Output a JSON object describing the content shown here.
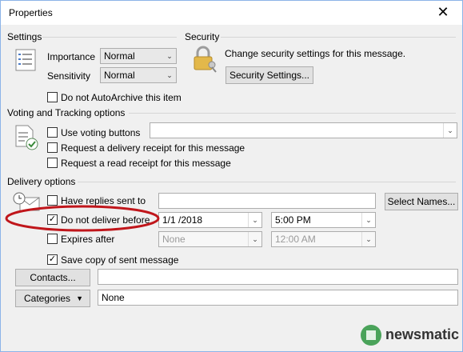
{
  "window": {
    "title": "Properties",
    "close_glyph": "✕"
  },
  "settings": {
    "group_label": "Settings",
    "importance_label": "Importance",
    "importance_value": "Normal",
    "sensitivity_label": "Sensitivity",
    "sensitivity_value": "Normal",
    "autoarchive_label": "Do not AutoArchive this item",
    "autoarchive_checked": false
  },
  "security": {
    "group_label": "Security",
    "description": "Change security settings for this message.",
    "button_label": "Security Settings..."
  },
  "voting": {
    "group_label": "Voting and Tracking options",
    "use_voting_label": "Use voting buttons",
    "delivery_receipt_label": "Request a delivery receipt for this message",
    "read_receipt_label": "Request a read receipt for this message"
  },
  "delivery": {
    "group_label": "Delivery options",
    "replies_label": "Have replies sent to",
    "select_names_label": "Select Names...",
    "deliver_before_label": "Do not deliver before",
    "deliver_before_checked": true,
    "deliver_date": "1/1 /2018",
    "deliver_time": "5:00 PM",
    "expires_label": "Expires after",
    "expires_date": "None",
    "expires_time": "12:00 AM",
    "save_copy_label": "Save copy of sent message",
    "save_copy_checked": true
  },
  "contacts": {
    "button_label": "Contacts...",
    "value": ""
  },
  "categories": {
    "button_label": "Categories",
    "value": "None"
  },
  "check_glyph": "✓",
  "dropdown_glyph": "⌄",
  "watermark": {
    "text": "newsmatic"
  },
  "colors": {
    "annotation_circle": "#c0161b",
    "window_border": "#8cb4e8",
    "brand_green": "#4aa35a"
  }
}
